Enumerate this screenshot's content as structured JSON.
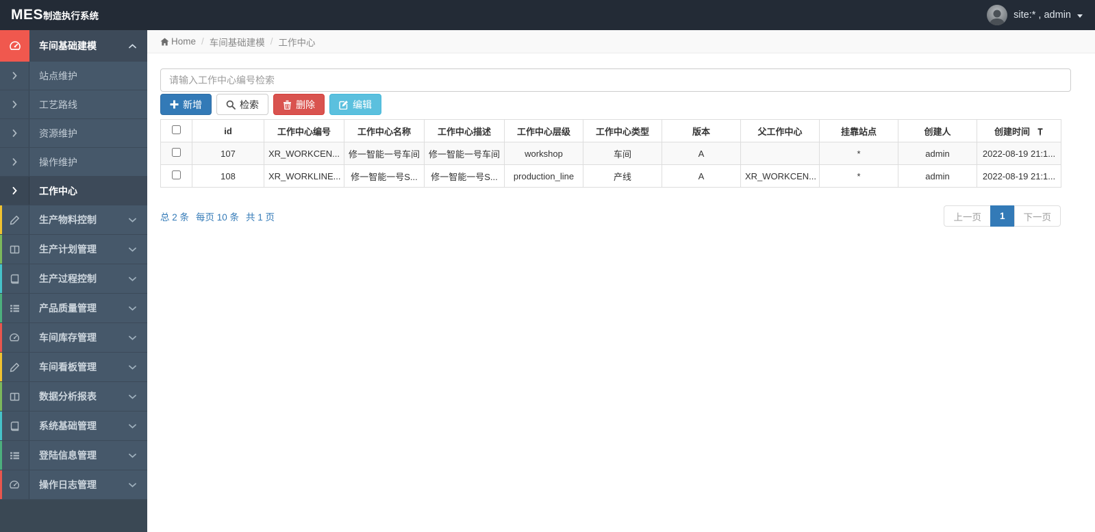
{
  "navbar": {
    "logo_main": "MES",
    "logo_sub": "制造执行系统",
    "user_label": "site:* , admin"
  },
  "sidebar": {
    "group": {
      "label": "车间基础建模"
    },
    "submenu": [
      {
        "label": "站点维护"
      },
      {
        "label": "工艺路线"
      },
      {
        "label": "资源维护"
      },
      {
        "label": "操作维护"
      },
      {
        "label": "工作中心",
        "active": true
      }
    ],
    "items": [
      {
        "label": "生产物料控制",
        "icon": "pencil-icon"
      },
      {
        "label": "生产计划管理",
        "icon": "columns-icon"
      },
      {
        "label": "生产过程控制",
        "icon": "book-icon"
      },
      {
        "label": "产品质量管理",
        "icon": "list-icon"
      },
      {
        "label": "车间库存管理",
        "icon": "dashboard-icon"
      },
      {
        "label": "车间看板管理",
        "icon": "pencil-icon"
      },
      {
        "label": "数据分析报表",
        "icon": "columns-icon"
      },
      {
        "label": "系统基础管理",
        "icon": "book-icon"
      },
      {
        "label": "登陆信息管理",
        "icon": "list-icon"
      },
      {
        "label": "操作日志管理",
        "icon": "dashboard-icon"
      }
    ]
  },
  "breadcrumb": {
    "home": "Home",
    "crumbs": [
      "车间基础建模",
      "工作中心"
    ]
  },
  "toolbar": {
    "search_placeholder": "请输入工作中心编号检索",
    "add_label": "新增",
    "search_label": "检索",
    "delete_label": "删除",
    "edit_label": "编辑"
  },
  "table": {
    "headers": [
      "id",
      "工作中心编号",
      "工作中心名称",
      "工作中心描述",
      "工作中心层级",
      "工作中心类型",
      "版本",
      "父工作中心",
      "挂靠站点",
      "创建人",
      "创建时间"
    ],
    "rows": [
      [
        "107",
        "XR_WORKCEN...",
        "修一智能一号车间",
        "修一智能一号车间",
        "workshop",
        "车间",
        "A",
        "",
        "*",
        "admin",
        "2022-08-19 21:1..."
      ],
      [
        "108",
        "XR_WORKLINE...",
        "修一智能一号S...",
        "修一智能一号S...",
        "production_line",
        "产线",
        "A",
        "XR_WORKCEN...",
        "*",
        "admin",
        "2022-08-19 21:1..."
      ]
    ]
  },
  "pagination": {
    "total": "总 2 条",
    "per_page": "每页 10 条",
    "pages": "共 1 页",
    "prev": "上一页",
    "page": "1",
    "next": "下一页"
  },
  "colors": {
    "accent": "#337ab7",
    "danger": "#d9534f",
    "info": "#5bc0de",
    "active_highlight": "#f0584e",
    "navbar_bg": "#232b36",
    "sidebar_bg": "#46586a"
  }
}
